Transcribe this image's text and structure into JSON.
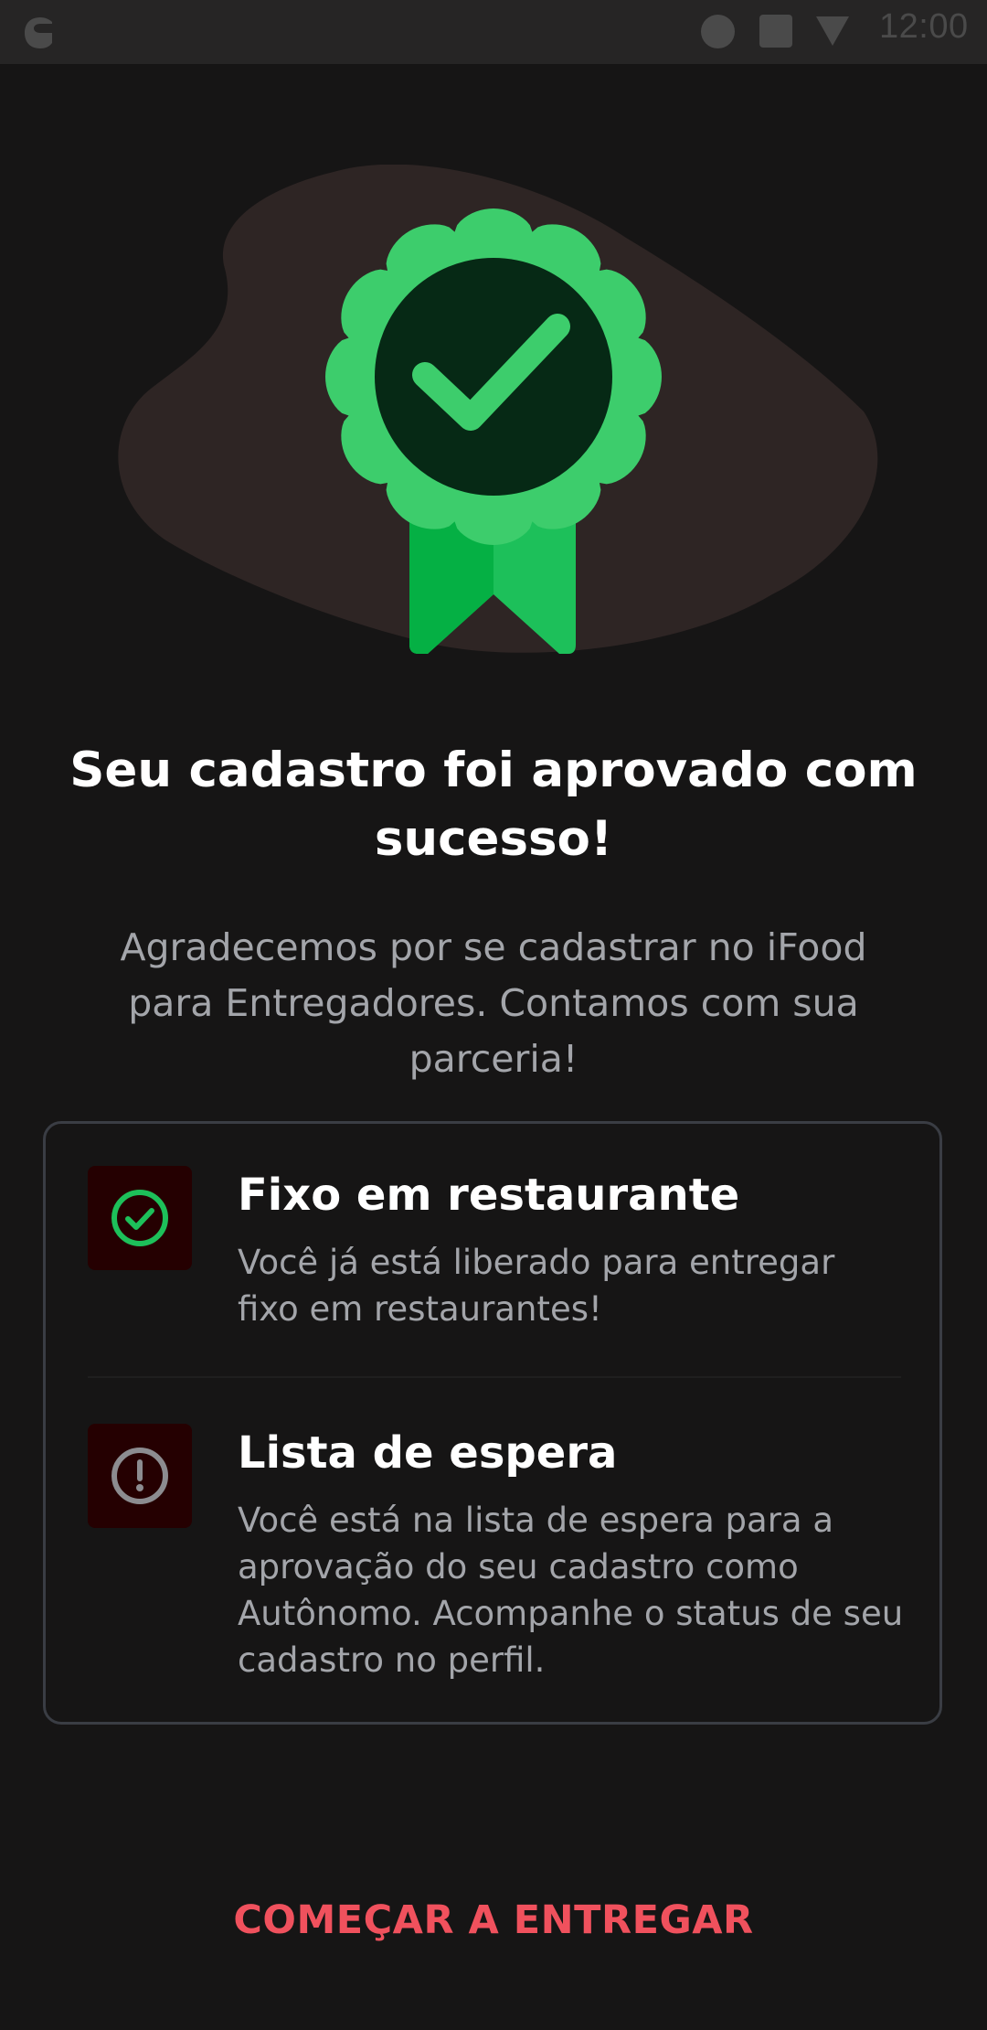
{
  "status_bar": {
    "time": "12:00",
    "icons": [
      "app-notification-icon",
      "circle-status-icon",
      "square-status-icon",
      "signal-icon"
    ]
  },
  "illustration": {
    "icon": "approved-badge-icon",
    "colors": {
      "blob": "#2e2524",
      "badge": "#3dcd6c",
      "badge_center": "#062915",
      "ribbon": "#1dc05a",
      "ribbon_dark": "#05b044",
      "check": "#3dcd6c"
    }
  },
  "title": "Seu cadastro foi aprovado com sucesso!",
  "subtitle": "Agradecemos por se cadastrar no iFood para Entregadores. Contamos com sua parceria!",
  "status_card": {
    "items": [
      {
        "icon": "check-circle-icon",
        "title": "Fixo em restaurante",
        "description": "Você já está liberado para entregar fixo em restaurantes!"
      },
      {
        "icon": "alert-circle-icon",
        "title": "Lista de espera",
        "description": "Você está na lista de espera para a aprovação do seu cadastro como Autônomo. Acompanhe o status de seu cadastro no perfil."
      }
    ]
  },
  "cta": {
    "label": "COMEÇAR A ENTREGAR",
    "color": "#f0515d"
  },
  "colors": {
    "background": "#161515",
    "status_bar": "#262525",
    "text_secondary": "#a3a5aa",
    "card_border": "#3a3d44",
    "icon_tile": "#250001",
    "success": "#1dc05a",
    "neutral_icon": "#8c8c90"
  }
}
